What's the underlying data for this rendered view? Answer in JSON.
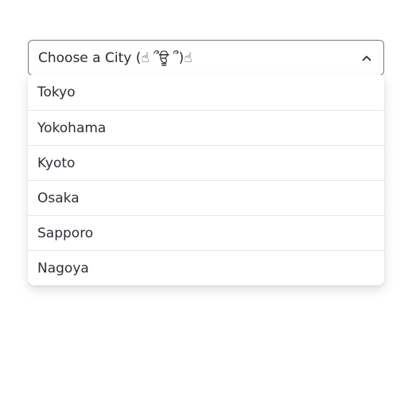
{
  "select": {
    "label": "Choose a City (☝ ՞ਊ ՞)☝",
    "icon": "chevron-up-icon"
  },
  "menu": {
    "items": [
      {
        "label": "Tokyo"
      },
      {
        "label": "Yokohama"
      },
      {
        "label": "Kyoto"
      },
      {
        "label": "Osaka"
      },
      {
        "label": "Sapporo"
      },
      {
        "label": "Nagoya"
      }
    ]
  }
}
